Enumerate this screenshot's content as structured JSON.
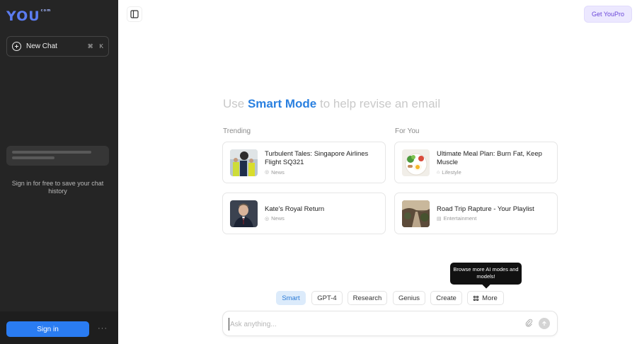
{
  "sidebar": {
    "logo": "YOU",
    "logo_mark": "com",
    "new_chat_label": "New Chat",
    "shortcut_keys": [
      "⌘",
      "K"
    ],
    "signin_hint": "Sign in for free to save your chat history",
    "signin_button": "Sign in",
    "more_label": "···"
  },
  "header": {
    "get_pro_label": "Get YouPro"
  },
  "hero": {
    "prefix": "Use",
    "accent": "Smart Mode",
    "suffix": "to help revise an email",
    "accent_color": "#2a80e0"
  },
  "trending": {
    "label": "Trending",
    "cards": [
      {
        "title": "Turbulent Tales: Singapore Airlines Flight SQ321",
        "category": "News",
        "category_icon": "news-icon"
      },
      {
        "title": "Kate's Royal Return",
        "category": "News",
        "category_icon": "news-icon"
      }
    ]
  },
  "for_you": {
    "label": "For You",
    "cards": [
      {
        "title": "Ultimate Meal Plan: Burn Fat, Keep Muscle",
        "category": "Lifestyle",
        "category_icon": "home-icon"
      },
      {
        "title": "Road Trip Rapture - Your Playlist",
        "category": "Entertainment",
        "category_icon": "film-icon"
      }
    ]
  },
  "tooltip": {
    "text": "Browse more AI modes and models!"
  },
  "modes": {
    "tabs": [
      "Smart",
      "GPT-4",
      "Research",
      "Genius",
      "Create",
      "More"
    ],
    "active": "Smart",
    "active_color": "#2a7ad6"
  },
  "composer": {
    "placeholder": "Ask anything...",
    "value": ""
  }
}
